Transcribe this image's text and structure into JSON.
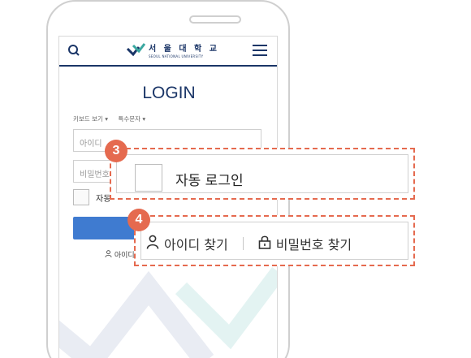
{
  "header": {
    "logo_name": "서 울 대 학 교",
    "logo_sub": "SEOUL NATIONAL UNIVERSITY"
  },
  "login": {
    "title": "LOGIN",
    "keyboard_view": "키보드 보기 ▾",
    "special_chars": "특수문자 ▾",
    "id_placeholder": "아이디",
    "pw_placeholder": "비밀번호",
    "auto_login_partial": "자동",
    "find_id_partial": "아이디"
  },
  "callout3": {
    "number": "3",
    "label": "자동 로그인"
  },
  "callout4": {
    "number": "4",
    "find_id": "아이디 찾기",
    "find_pw": "비밀번호 찾기"
  },
  "colors": {
    "accent": "#e56a4f",
    "brand": "#1a3567",
    "button": "#3f7bd0"
  }
}
